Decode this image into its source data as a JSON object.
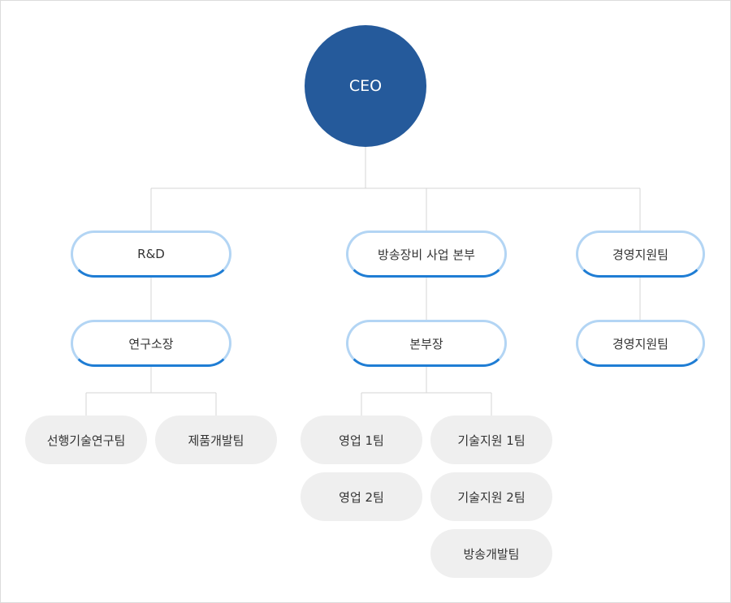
{
  "ceo": {
    "label": "CEO"
  },
  "divisions": {
    "rnd": {
      "label": "R&D",
      "head": "연구소장",
      "teams": [
        "선행기술연구팀",
        "제품개발팀"
      ]
    },
    "broadcast": {
      "label": "방송장비 사업 본부",
      "head": "본부장",
      "teams": [
        "영업 1팀",
        "기술지원 1팀",
        "영업 2팀",
        "기술지원 2팀",
        "방송개발팀"
      ]
    },
    "management": {
      "label": "경영지원팀",
      "head": "경영지원팀"
    }
  },
  "colors": {
    "ceo_fill": "#255a9b",
    "pill_border_top": "#b3d5f4",
    "pill_border_bottom": "#1f7dd4",
    "team_fill": "#efefef",
    "connector": "#d6d6d6"
  }
}
